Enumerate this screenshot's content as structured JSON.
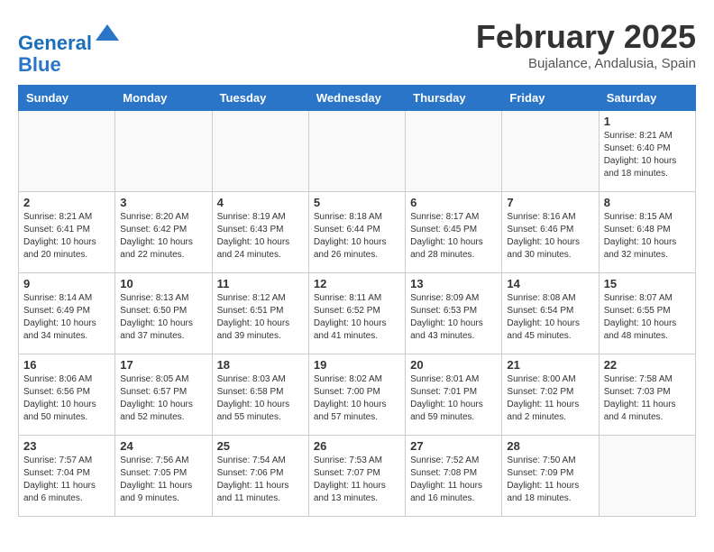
{
  "logo": {
    "text_general": "General",
    "text_blue": "Blue"
  },
  "header": {
    "month": "February 2025",
    "location": "Bujalance, Andalusia, Spain"
  },
  "weekdays": [
    "Sunday",
    "Monday",
    "Tuesday",
    "Wednesday",
    "Thursday",
    "Friday",
    "Saturday"
  ],
  "weeks": [
    [
      {
        "day": "",
        "info": ""
      },
      {
        "day": "",
        "info": ""
      },
      {
        "day": "",
        "info": ""
      },
      {
        "day": "",
        "info": ""
      },
      {
        "day": "",
        "info": ""
      },
      {
        "day": "",
        "info": ""
      },
      {
        "day": "1",
        "info": "Sunrise: 8:21 AM\nSunset: 6:40 PM\nDaylight: 10 hours\nand 18 minutes."
      }
    ],
    [
      {
        "day": "2",
        "info": "Sunrise: 8:21 AM\nSunset: 6:41 PM\nDaylight: 10 hours\nand 20 minutes."
      },
      {
        "day": "3",
        "info": "Sunrise: 8:20 AM\nSunset: 6:42 PM\nDaylight: 10 hours\nand 22 minutes."
      },
      {
        "day": "4",
        "info": "Sunrise: 8:19 AM\nSunset: 6:43 PM\nDaylight: 10 hours\nand 24 minutes."
      },
      {
        "day": "5",
        "info": "Sunrise: 8:18 AM\nSunset: 6:44 PM\nDaylight: 10 hours\nand 26 minutes."
      },
      {
        "day": "6",
        "info": "Sunrise: 8:17 AM\nSunset: 6:45 PM\nDaylight: 10 hours\nand 28 minutes."
      },
      {
        "day": "7",
        "info": "Sunrise: 8:16 AM\nSunset: 6:46 PM\nDaylight: 10 hours\nand 30 minutes."
      },
      {
        "day": "8",
        "info": "Sunrise: 8:15 AM\nSunset: 6:48 PM\nDaylight: 10 hours\nand 32 minutes."
      }
    ],
    [
      {
        "day": "9",
        "info": "Sunrise: 8:14 AM\nSunset: 6:49 PM\nDaylight: 10 hours\nand 34 minutes."
      },
      {
        "day": "10",
        "info": "Sunrise: 8:13 AM\nSunset: 6:50 PM\nDaylight: 10 hours\nand 37 minutes."
      },
      {
        "day": "11",
        "info": "Sunrise: 8:12 AM\nSunset: 6:51 PM\nDaylight: 10 hours\nand 39 minutes."
      },
      {
        "day": "12",
        "info": "Sunrise: 8:11 AM\nSunset: 6:52 PM\nDaylight: 10 hours\nand 41 minutes."
      },
      {
        "day": "13",
        "info": "Sunrise: 8:09 AM\nSunset: 6:53 PM\nDaylight: 10 hours\nand 43 minutes."
      },
      {
        "day": "14",
        "info": "Sunrise: 8:08 AM\nSunset: 6:54 PM\nDaylight: 10 hours\nand 45 minutes."
      },
      {
        "day": "15",
        "info": "Sunrise: 8:07 AM\nSunset: 6:55 PM\nDaylight: 10 hours\nand 48 minutes."
      }
    ],
    [
      {
        "day": "16",
        "info": "Sunrise: 8:06 AM\nSunset: 6:56 PM\nDaylight: 10 hours\nand 50 minutes."
      },
      {
        "day": "17",
        "info": "Sunrise: 8:05 AM\nSunset: 6:57 PM\nDaylight: 10 hours\nand 52 minutes."
      },
      {
        "day": "18",
        "info": "Sunrise: 8:03 AM\nSunset: 6:58 PM\nDaylight: 10 hours\nand 55 minutes."
      },
      {
        "day": "19",
        "info": "Sunrise: 8:02 AM\nSunset: 7:00 PM\nDaylight: 10 hours\nand 57 minutes."
      },
      {
        "day": "20",
        "info": "Sunrise: 8:01 AM\nSunset: 7:01 PM\nDaylight: 10 hours\nand 59 minutes."
      },
      {
        "day": "21",
        "info": "Sunrise: 8:00 AM\nSunset: 7:02 PM\nDaylight: 11 hours\nand 2 minutes."
      },
      {
        "day": "22",
        "info": "Sunrise: 7:58 AM\nSunset: 7:03 PM\nDaylight: 11 hours\nand 4 minutes."
      }
    ],
    [
      {
        "day": "23",
        "info": "Sunrise: 7:57 AM\nSunset: 7:04 PM\nDaylight: 11 hours\nand 6 minutes."
      },
      {
        "day": "24",
        "info": "Sunrise: 7:56 AM\nSunset: 7:05 PM\nDaylight: 11 hours\nand 9 minutes."
      },
      {
        "day": "25",
        "info": "Sunrise: 7:54 AM\nSunset: 7:06 PM\nDaylight: 11 hours\nand 11 minutes."
      },
      {
        "day": "26",
        "info": "Sunrise: 7:53 AM\nSunset: 7:07 PM\nDaylight: 11 hours\nand 13 minutes."
      },
      {
        "day": "27",
        "info": "Sunrise: 7:52 AM\nSunset: 7:08 PM\nDaylight: 11 hours\nand 16 minutes."
      },
      {
        "day": "28",
        "info": "Sunrise: 7:50 AM\nSunset: 7:09 PM\nDaylight: 11 hours\nand 18 minutes."
      },
      {
        "day": "",
        "info": ""
      }
    ]
  ]
}
